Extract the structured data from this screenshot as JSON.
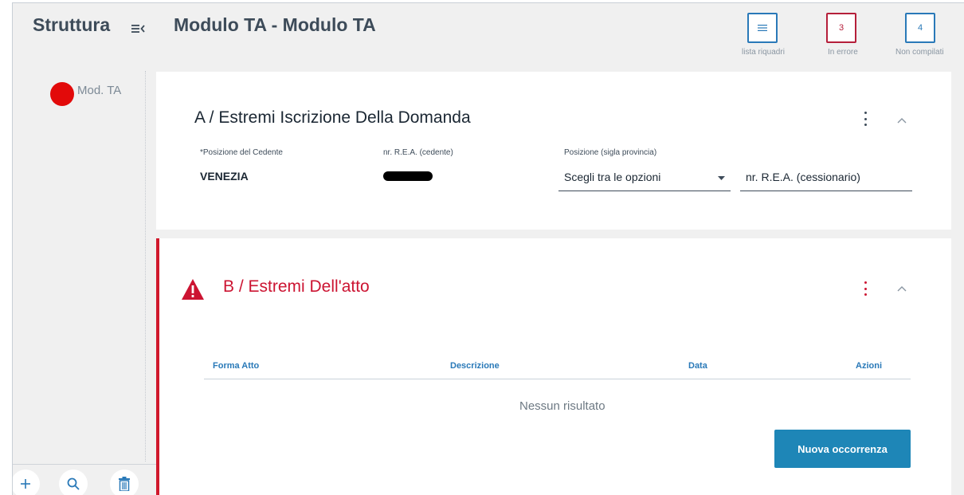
{
  "sidebar": {
    "title": "Struttura",
    "items": [
      {
        "label": "Mod. TA",
        "status_color": "#e20a0a"
      }
    ],
    "footer_icons": [
      "plus-icon",
      "search-icon",
      "trash-icon"
    ]
  },
  "header": {
    "title": "Modulo TA - Modulo TA",
    "buttons": [
      {
        "value": "",
        "icon": "list-icon",
        "label": "lista riquadri"
      },
      {
        "value": "3",
        "label": "In errore",
        "color": "#b51f3a"
      },
      {
        "value": "4",
        "label": "Non compilati",
        "color": "#2979b8"
      }
    ]
  },
  "section_a": {
    "title": "A / Estremi Iscrizione Della Domanda",
    "fields": [
      {
        "label": "*Posizione del Cedente",
        "value": "VENEZIA"
      },
      {
        "label": "nr. R.E.A. (cedente)",
        "value": ""
      },
      {
        "label": "Posizione (sigla provincia)",
        "value": "Scegli tra le opzioni"
      },
      {
        "label": "",
        "value": "nr. R.E.A. (cessionario)"
      }
    ]
  },
  "section_b": {
    "title": "B / Estremi Dell'atto",
    "columns": [
      "Forma Atto",
      "Descrizione",
      "Data",
      "Azioni"
    ],
    "empty_text": "Nessun risultato",
    "button": "Nuova occorrenza"
  },
  "colors": {
    "accent": "#2979b8",
    "error": "#cc1432",
    "button": "#1e86b7"
  }
}
